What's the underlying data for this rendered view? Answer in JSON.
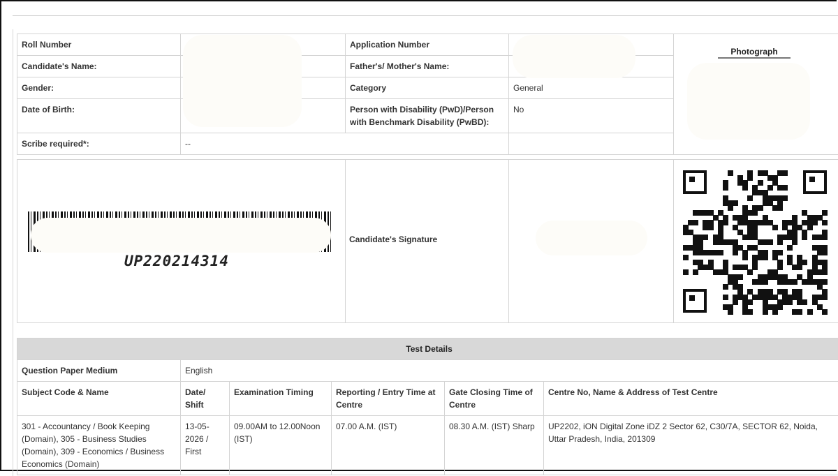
{
  "info": {
    "roll_number_label": "Roll Number",
    "application_number_label": "Application Number",
    "candidate_name_label": "Candidate's Name:",
    "parent_name_label": "Father's/ Mother's Name:",
    "gender_label": "Gender:",
    "category_label": "Category",
    "category_value": "General",
    "dob_label": "Date of Birth:",
    "pwd_label": "Person with Disability (PwD)/Person with Benchmark Disability (PwBD):",
    "pwd_value": "No",
    "scribe_label": "Scribe required*:",
    "scribe_value": "--",
    "photograph_label": "Photograph"
  },
  "barcode": {
    "roll_text": "UP220214314"
  },
  "signature": {
    "label": "Candidate's Signature"
  },
  "test": {
    "title": "Test Details",
    "medium_label": "Question Paper Medium",
    "medium_value": "English",
    "headers": {
      "subject": "Subject Code & Name",
      "date": "Date/ Shift",
      "timing": "Examination Timing",
      "reporting": "Reporting / Entry Time at Centre",
      "gate": "Gate Closing Time of Centre",
      "centre": "Centre No, Name & Address of Test Centre"
    },
    "row": {
      "subject": "301 - Accountancy / Book Keeping (Domain), 305 - Business Studies (Domain), 309 - Economics / Business Economics (Domain)",
      "date": "13-05-2026 / First",
      "timing": "09.00AM to 12.00Noon (IST)",
      "reporting": "07.00 A.M. (IST)",
      "gate": "08.30 A.M. (IST) Sharp",
      "centre": "UP2202, iON Digital Zone iDZ 2 Sector 62, C30/7A, SECTOR 62, Noida, Uttar Pradesh, India, 201309"
    }
  }
}
